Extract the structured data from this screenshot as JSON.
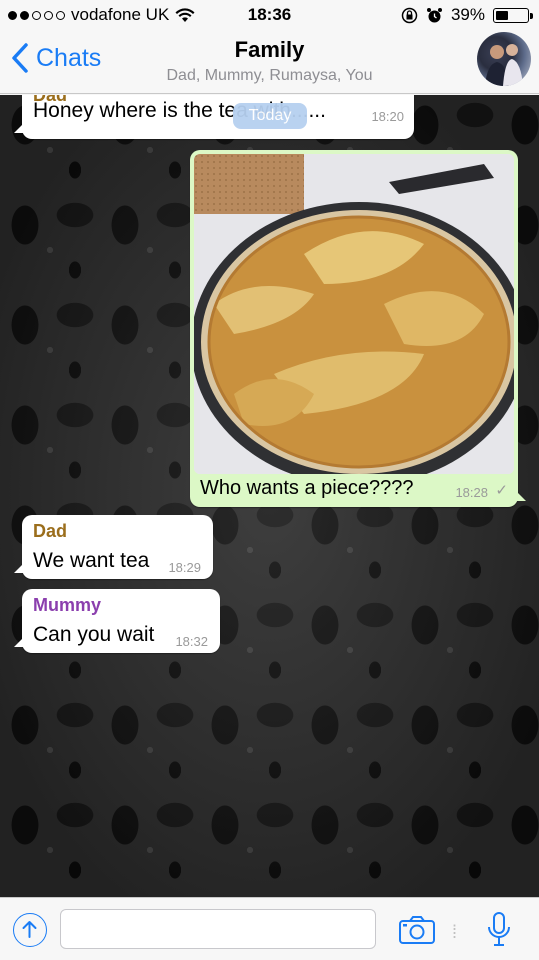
{
  "status_bar": {
    "carrier": "vodafone UK",
    "time": "18:36",
    "battery_percent": "39%",
    "battery_level": 0.39
  },
  "header": {
    "back_label": "Chats",
    "title": "Family",
    "members": "Dad, Mummy, Rumaysa, You"
  },
  "date_divider": "Today",
  "messages": [
    {
      "sender": "Dad",
      "text": "Honey where is the tea with......",
      "time": "18:20",
      "direction": "incoming",
      "sender_color": "#9b6e1c"
    },
    {
      "type": "image",
      "image_description": "pie",
      "text": "Who wants a piece????",
      "time": "18:28",
      "direction": "outgoing",
      "status": "delivered"
    },
    {
      "sender": "Dad",
      "text": "We want tea",
      "time": "18:29",
      "direction": "incoming",
      "sender_color": "#9b6e1c"
    },
    {
      "sender": "Mummy",
      "text": "Can you wait",
      "time": "18:32",
      "direction": "incoming",
      "sender_color": "#8b3fae"
    }
  ],
  "input_bar": {
    "placeholder": "",
    "icons": [
      "upload-icon",
      "camera-icon",
      "microphone-icon"
    ]
  },
  "colors": {
    "accent": "#1a7cf5",
    "outgoing_bubble": "#dcf8c6",
    "incoming_bubble": "#ffffff"
  }
}
